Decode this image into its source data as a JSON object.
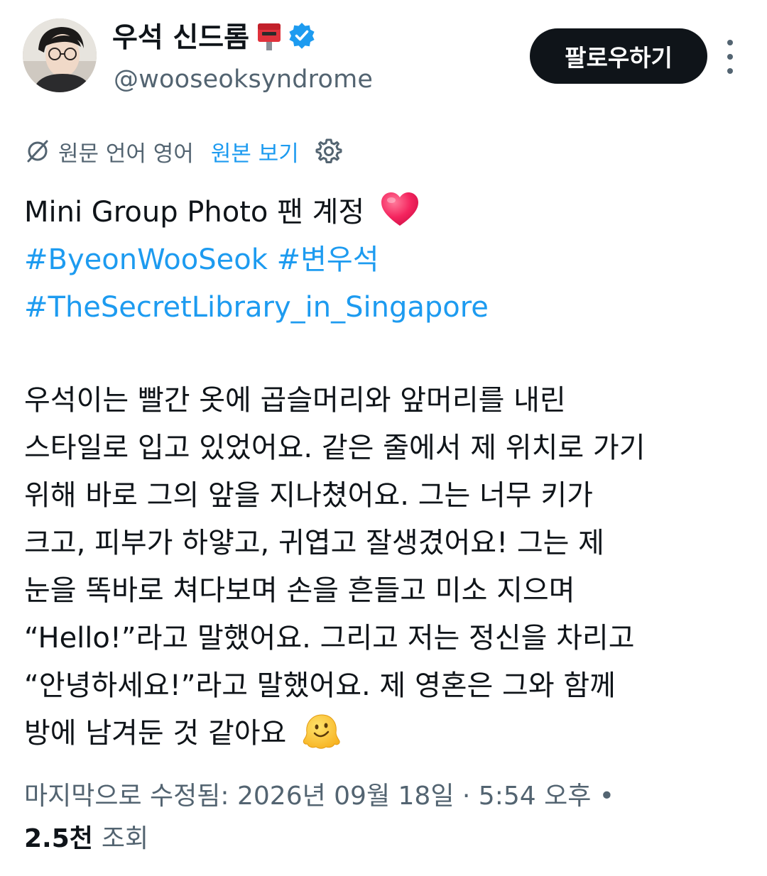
{
  "header": {
    "display_name": "우석 신드롬",
    "handle": "@wooseoksyndrome",
    "follow_label": "팔로우하기",
    "name_emoji_icon": "postbox-emoji-icon",
    "verified_icon": "verified-badge-icon",
    "more_icon": "more-vertical-icon"
  },
  "translation": {
    "language_note": "원문 언어 영어",
    "show_original_label": "원본 보기",
    "translate_icon": "translate-slash-icon",
    "settings_icon": "gear-icon"
  },
  "tweet": {
    "title_text": "Mini Group Photo 팬 계정",
    "title_emoji": "heart-emoji-icon",
    "hashtags": [
      "#ByeonWooSeok",
      "#변우석",
      "#TheSecretLibrary_in_Singapore"
    ],
    "body_lines": [
      "우석이는 빨간 옷에 곱슬머리와 앞머리를 내린",
      "스타일로 입고 있었어요. 같은 줄에서 제 위치로 가기",
      "위해 바로 그의 앞을 지나쳤어요. 그는 너무 키가",
      "크고, 피부가 하얗고, 귀엽고 잘생겼어요! 그는 제",
      "눈을 똑바로 쳐다보며 손을 흔들고 미소 지으며",
      "“Hello!”라고 말했어요. 그리고 저는 정신을 차리고",
      "“안녕하세요!”라고 말했어요. 제 영혼은 그와 함께",
      "방에 남겨둔 것 같아요"
    ],
    "end_emoji": "melting-face-emoji-icon"
  },
  "meta": {
    "edited_line": "마지막으로 수정됨: 2026년 09월 18일 · 5:54 오후 •",
    "views_count": "2.5천",
    "views_label": "조회"
  },
  "colors": {
    "text_primary": "#0f1419",
    "text_secondary": "#536471",
    "link_blue": "#1d9bf0",
    "follow_button_bg": "#0f1419",
    "verified_blue": "#1d9bf0",
    "heart_red": "#f4245e",
    "postbox_red": "#e0323c"
  }
}
